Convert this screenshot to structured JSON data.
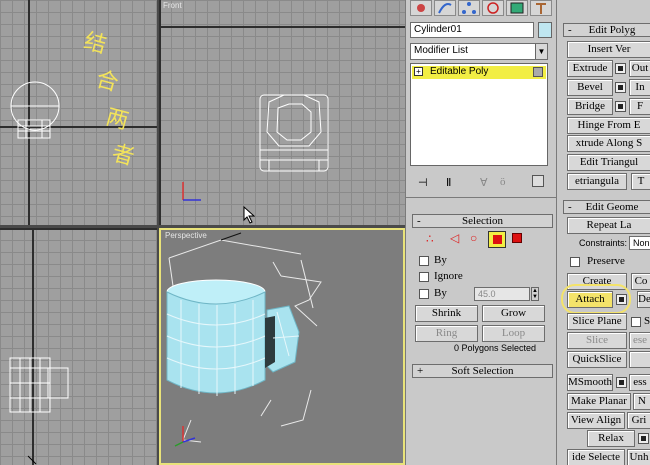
{
  "viewports": {
    "top_left_label": "",
    "front_label": "Front",
    "perspective_label": "Perspective",
    "annotation": "结合两者"
  },
  "modify_panel": {
    "object_name": "Cylinder01",
    "modifier_list": "Modifier List",
    "stack_item": "Editable Poly"
  },
  "selection": {
    "header": "Selection",
    "header_sign": "-",
    "by_vertex": "By",
    "ignore": "Ignore",
    "by_angle": "By",
    "angle_value": "45.0",
    "shrink": "Shrink",
    "grow": "Grow",
    "ring": "Ring",
    "loop": "Loop",
    "status": "0 Polygons Selected"
  },
  "soft_selection": {
    "header": "Soft Selection",
    "header_sign": "+"
  },
  "edit_polygons": {
    "header": "Edit Polyg",
    "header_sign": "-",
    "insert_vertex": "Insert Ver",
    "extrude": "Extrude",
    "outline": "Out",
    "bevel": "Bevel",
    "inset": "In",
    "bridge": "Bridge",
    "flip": "F",
    "hinge": "Hinge From E",
    "extrude_along": "xtrude Along S",
    "edit_tri": "Edit Triangul",
    "retri": "etriangula",
    "turn": "T"
  },
  "edit_geometry": {
    "header": "Edit Geome",
    "header_sign": "-",
    "repeat_last": "Repeat La",
    "constraints_label": "Constraints:",
    "constraints_value": "Non",
    "preserve_uvs": "Preserve",
    "create": "Create",
    "collapse": "Co",
    "attach": "Attach",
    "detach": "De",
    "slice_plane": "Slice Plane",
    "split": "S",
    "slice": "Slice",
    "reset_plane": "ese",
    "quickslice": "QuickSlice",
    "msmooth": "MSmooth",
    "msmooth_right": "ess",
    "make_planar": "Make Planar",
    "planar_right": "N",
    "view_align": "View Align",
    "grid_align": "Gri",
    "relax": "Relax",
    "hide_selected": "ide Selecte",
    "unhide": "Unh"
  },
  "colors": {
    "viewport_bg": "#9f9f9f",
    "perspective_bg": "#7d7d7d",
    "active_border": "#e9e37a",
    "stack_highlight": "#f2ee44",
    "annotation": "#f3e35a",
    "mug": "#a9e3ef",
    "attach_highlight": "#f4e36a"
  }
}
